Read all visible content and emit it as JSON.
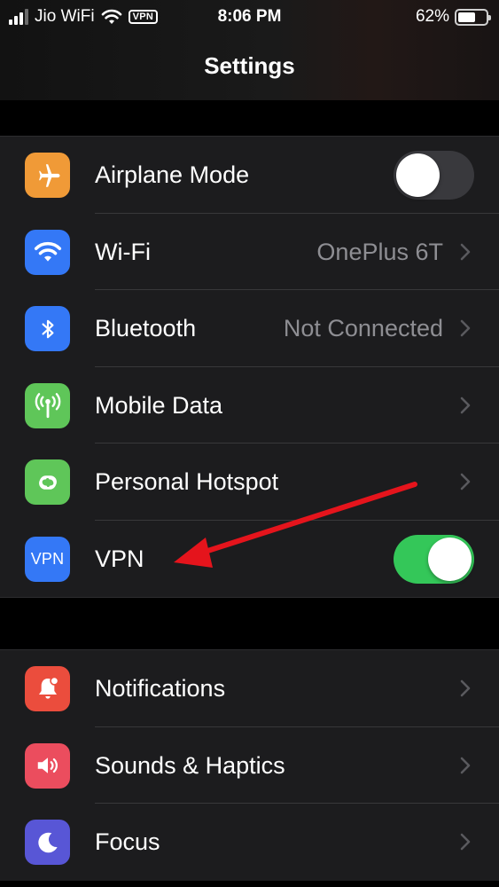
{
  "status_bar": {
    "carrier": "Jio WiFi",
    "vpn_badge": "VPN",
    "time": "8:06 PM",
    "battery_percent": "62%",
    "battery_level": 0.62
  },
  "nav": {
    "title": "Settings"
  },
  "group1": [
    {
      "label": "Airplane Mode",
      "icon": "airplane-icon",
      "color": "#f09a37",
      "control": "toggle",
      "on": false
    },
    {
      "label": "Wi-Fi",
      "value": "OnePlus 6T",
      "icon": "wifi-icon",
      "color": "#3478f6",
      "control": "chevron"
    },
    {
      "label": "Bluetooth",
      "value": "Not Connected",
      "icon": "bluetooth-icon",
      "color": "#3478f6",
      "control": "chevron"
    },
    {
      "label": "Mobile Data",
      "icon": "antenna-icon",
      "color": "#5fc659",
      "control": "chevron"
    },
    {
      "label": "Personal Hotspot",
      "icon": "link-icon",
      "color": "#5fc659",
      "control": "chevron"
    },
    {
      "label": "VPN",
      "icon_text": "VPN",
      "icon": "vpn-icon",
      "color": "#3478f6",
      "control": "toggle",
      "on": true
    }
  ],
  "group2": [
    {
      "label": "Notifications",
      "icon": "bell-icon",
      "color": "#eb4d3d",
      "control": "chevron"
    },
    {
      "label": "Sounds & Haptics",
      "icon": "speaker-icon",
      "color": "#eb4d5e",
      "control": "chevron"
    },
    {
      "label": "Focus",
      "icon": "moon-icon",
      "color": "#5856d6",
      "control": "chevron"
    }
  ],
  "annotation": {
    "arrow_color": "#e5141c"
  }
}
